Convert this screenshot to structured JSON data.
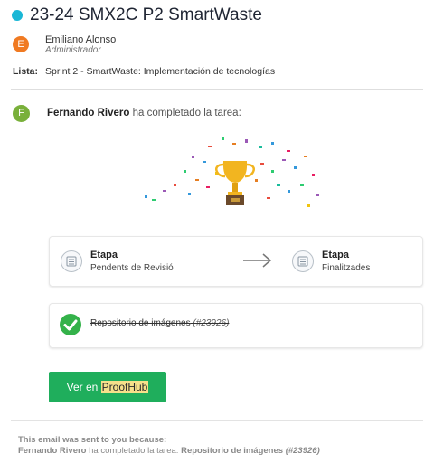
{
  "header": {
    "title": "23-24 SMX2C P2 SmartWaste",
    "status_color": "#1ab7d6"
  },
  "author": {
    "initial": "E",
    "name": "Emiliano Alonso",
    "role": "Administrador",
    "avatar_color": "#f07a22"
  },
  "list": {
    "label": "Lista:",
    "value": "Sprint 2 - SmartWaste: Implementación de tecnologías"
  },
  "activity": {
    "initial": "F",
    "avatar_color": "#79b03a",
    "actor": "Fernando Rivero",
    "action": " ha completado la tarea:"
  },
  "stages": {
    "from": {
      "label": "Etapa",
      "value": "Pendents de Revisió"
    },
    "to": {
      "label": "Etapa",
      "value": "Finalitzades"
    }
  },
  "task": {
    "name": "Repositorio de imágenes",
    "ref": "(#23926)"
  },
  "button": {
    "prefix": "Ver en ",
    "highlight": "ProofHub"
  },
  "footer": {
    "line1": "This email was sent to you because:",
    "actor": "Fernando Rivero",
    "action": " ha completado la tarea: ",
    "task": "Repositorio de imágenes",
    "ref": "(#23926)"
  },
  "icons": [
    "trophy-icon",
    "stage-icon",
    "arrow-right-icon",
    "checkmark-icon"
  ]
}
